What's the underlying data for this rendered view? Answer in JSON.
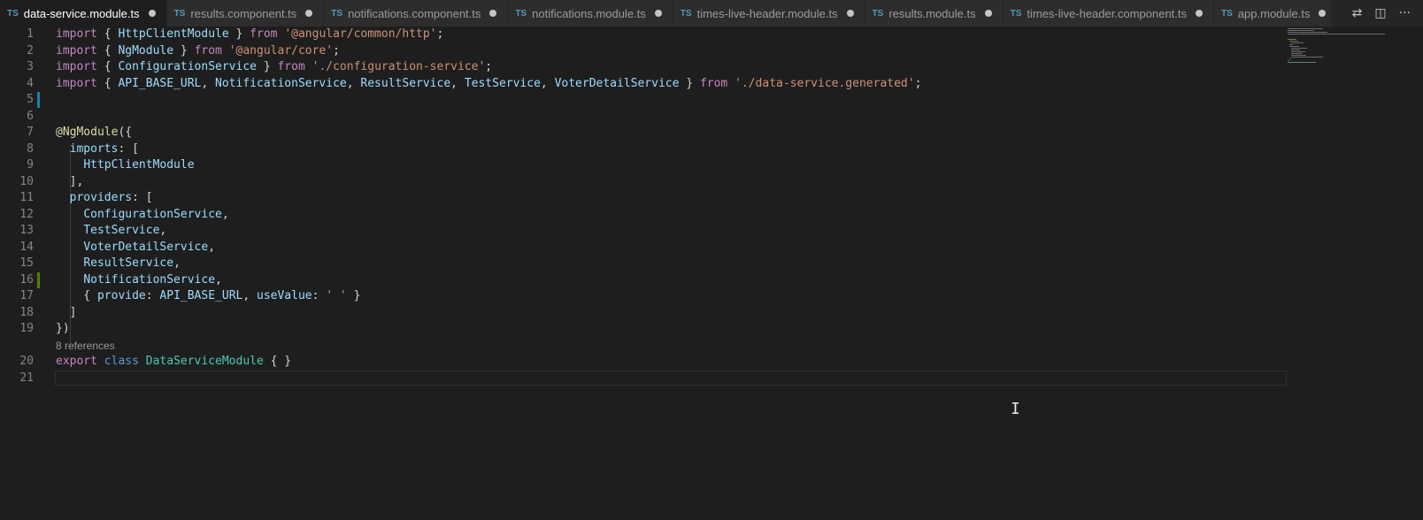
{
  "tabs": [
    {
      "icon": "TS",
      "label": "data-service.module.ts",
      "active": true
    },
    {
      "icon": "TS",
      "label": "results.component.ts",
      "active": false
    },
    {
      "icon": "TS",
      "label": "notifications.component.ts",
      "active": false
    },
    {
      "icon": "TS",
      "label": "notifications.module.ts",
      "active": false
    },
    {
      "icon": "TS",
      "label": "times-live-header.module.ts",
      "active": false
    },
    {
      "icon": "TS",
      "label": "results.module.ts",
      "active": false
    },
    {
      "icon": "TS",
      "label": "times-live-header.component.ts",
      "active": false
    },
    {
      "icon": "TS",
      "label": "app.module.ts",
      "active": false
    }
  ],
  "editor": {
    "line_numbers": [
      "1",
      "2",
      "3",
      "4",
      "5",
      "6",
      "7",
      "8",
      "9",
      "10",
      "11",
      "12",
      "13",
      "14",
      "15",
      "16",
      "17",
      "18",
      "19",
      "20",
      "21"
    ],
    "lines": [
      "import { HttpClientModule } from '@angular/common/http';",
      "import { NgModule } from '@angular/core';",
      "import { ConfigurationService } from './configuration-service';",
      "import { API_BASE_URL, NotificationService, ResultService, TestService, VoterDetailService } from './data-service.generated';",
      "",
      "",
      "@NgModule({",
      "  imports: [",
      "    HttpClientModule",
      "  ],",
      "  providers: [",
      "    ConfigurationService,",
      "    TestService,",
      "    VoterDetailService,",
      "    ResultService,",
      "    NotificationService,",
      "    { provide: API_BASE_URL, useValue: ' ' }",
      "  ]",
      "})",
      "export class DataServiceModule { }",
      ""
    ],
    "codelens": "8 references"
  },
  "colors": {
    "editor_bg": "#1e1e1e",
    "keyword": "#c586c0",
    "string": "#ce9178",
    "identifier": "#9cdcfe",
    "class": "#4ec9b0",
    "gutter_modified": "#1b81a8",
    "gutter_added": "#587c0c"
  },
  "icons": {
    "compare": "compare-changes-icon",
    "split": "split-editor-icon",
    "more": "more-actions-icon"
  }
}
